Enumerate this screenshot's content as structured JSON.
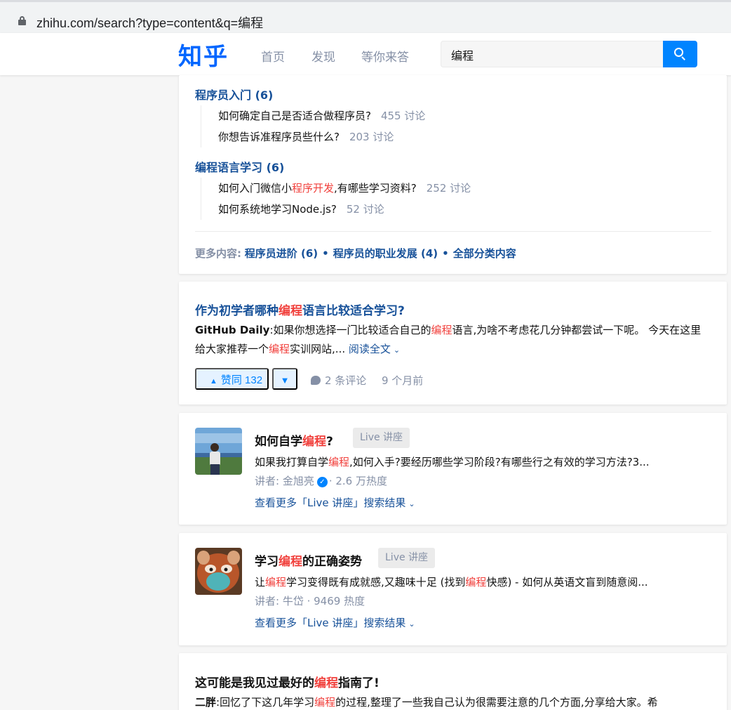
{
  "browser": {
    "url": "zhihu.com/search?type=content&q=编程"
  },
  "header": {
    "logo": "知乎",
    "nav": [
      "首页",
      "发现",
      "等你来答"
    ],
    "search_value": "编程"
  },
  "topic_card": {
    "categories": [
      {
        "title": "程序员入门 (6)",
        "questions": [
          {
            "pre": "如何确定自己是否适合做程序员?",
            "hl": "",
            "post": "",
            "count": "455 讨论"
          },
          {
            "pre": "你想告诉准程序员些什么?",
            "hl": "",
            "post": "",
            "count": "203 讨论"
          }
        ]
      },
      {
        "title": "编程语言学习 (6)",
        "questions": [
          {
            "pre": "如何入门微信小",
            "hl": "程序开发",
            "post": ",有哪些学习资料?",
            "count": "252 讨论"
          },
          {
            "pre": "如何系统地学习Node.js?",
            "hl": "",
            "post": "",
            "count": "52 讨论"
          }
        ]
      }
    ],
    "more_label": "更多内容:",
    "more_links": [
      "程序员进阶 (6)",
      "程序员的职业发展 (4)",
      "全部分类内容"
    ]
  },
  "answer_card": {
    "title_pre": "作为初学者哪种",
    "title_hl": "编程",
    "title_post": "语言比较适合学习?",
    "author": "GitHub Daily",
    "ex_1": ":如果你想选择一门比较适合自己的",
    "ex_hl1": "编程",
    "ex_2": "语言,为啥不考虑花几分钟都尝试一下呢。 今天在这里给大家推荐一个",
    "ex_hl2": "编程",
    "ex_3": "实训网站,...",
    "read_more": "阅读全文",
    "vote_up": "赞同 132",
    "comments": "2 条评论",
    "time": "9 个月前"
  },
  "live_cards": [
    {
      "title_pre": "如何自学",
      "title_hl": "编程",
      "title_post": "?",
      "badge": "Live 讲座",
      "desc_pre": "如果我打算自学",
      "desc_hl": "编程",
      "desc_post": ",如何入手?要经历哪些学习阶段?有哪些行之有效的学习方法?3...",
      "speaker": "讲者: 金旭亮",
      "heat": "· 2.6 万热度",
      "more": "查看更多「Live 讲座」搜索结果"
    },
    {
      "title_pre": "学习",
      "title_hl": "编程",
      "title_post": "的正确姿势",
      "badge": "Live 讲座",
      "desc_pre": "让",
      "desc_hl": "编程",
      "desc_mid": "学习变得既有成就感,又趣味十足 (找到",
      "desc_hl2": "编程",
      "desc_post": "快感) - 如何从英语文盲到随意阅...",
      "speaker": "讲者: 牛岱 · 9469 热度",
      "more": "查看更多「Live 讲座」搜索结果"
    }
  ],
  "article_card": {
    "title_pre": "这可能是我见过最好的",
    "title_hl": "编程",
    "title_post": "指南了!",
    "author": "二胖",
    "ex_1": ":回忆了下这几年学习",
    "ex_hl": "编程",
    "ex_2": "的过程,整理了一些我自己认为很需要注意的几个方面,分享给大家。希"
  }
}
